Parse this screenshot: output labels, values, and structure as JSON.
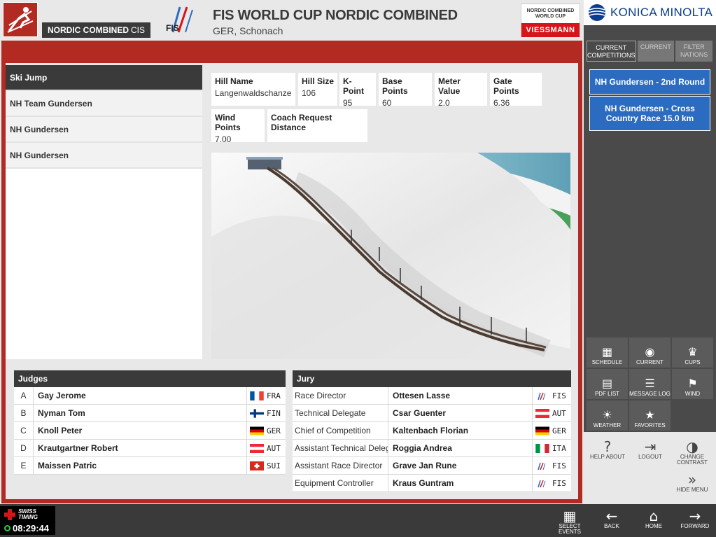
{
  "header": {
    "badge_main": "NORDIC COMBINED",
    "badge_suffix": "CIS",
    "fis_text": "FIS",
    "title": "FIS WORLD CUP NORDIC COMBINED",
    "subtitle": "GER, Schonach",
    "sponsor_top": "NORDIC COMBINED WORLD CUP",
    "sponsor_bottom": "VIESSMANN",
    "km_logo": "KONICA MINOLTA"
  },
  "competitions": [
    {
      "label": "Ski Jump",
      "active": true
    },
    {
      "label": "NH Team Gundersen",
      "active": false
    },
    {
      "label": "NH Gundersen",
      "active": false
    },
    {
      "label": "NH Gundersen",
      "active": false
    }
  ],
  "hill": {
    "name_label": "Hill Name",
    "name_value": "Langenwaldschanze",
    "size_label": "Hill Size",
    "size_value": "106",
    "kpoint_label": "K-Point",
    "kpoint_value": "95",
    "base_label": "Base Points",
    "base_value": "60",
    "meter_label": "Meter Value",
    "meter_value": "2.0",
    "gate_label": "Gate Points",
    "gate_value": "6.36",
    "wind_label": "Wind Points",
    "wind_value": "7.00",
    "coach_label": "Coach Request Distance",
    "coach_value": ""
  },
  "judges": {
    "title": "Judges",
    "rows": [
      {
        "letter": "A",
        "name": "Gay Jerome",
        "nation": "FRA"
      },
      {
        "letter": "B",
        "name": "Nyman Tom",
        "nation": "FIN"
      },
      {
        "letter": "C",
        "name": "Knoll Peter",
        "nation": "GER"
      },
      {
        "letter": "D",
        "name": "Krautgartner Robert",
        "nation": "AUT"
      },
      {
        "letter": "E",
        "name": "Maissen Patric",
        "nation": "SUI"
      }
    ]
  },
  "jury": {
    "title": "Jury",
    "rows": [
      {
        "role": "Race Director",
        "name": "Ottesen Lasse",
        "nation": "FIS"
      },
      {
        "role": "Technical Delegate",
        "name": "Csar Guenter",
        "nation": "AUT"
      },
      {
        "role": "Chief of Competition",
        "name": "Kaltenbach Florian",
        "nation": "GER"
      },
      {
        "role": "Assistant Technical Delegate",
        "name": "Roggia Andrea",
        "nation": "ITA"
      },
      {
        "role": "Assistant Race Director",
        "name": "Grave Jan Rune",
        "nation": "FIS"
      },
      {
        "role": "Equipment Controller",
        "name": "Kraus Guntram",
        "nation": "FIS"
      }
    ]
  },
  "sidebar": {
    "tabs": [
      {
        "label": "CURRENT COMPETITIONS",
        "active": true
      },
      {
        "label": "CURRENT",
        "active": false
      },
      {
        "label": "FILTER NATIONS",
        "active": false
      }
    ],
    "items": [
      {
        "label": "NH Gundersen - 2nd Round"
      },
      {
        "label": "NH Gundersen - Cross Country Race 15.0 km"
      }
    ],
    "menu": [
      {
        "label": "SCHEDULE",
        "icon": "calendar-icon",
        "glyph": "▦"
      },
      {
        "label": "CURRENT",
        "icon": "eye-icon",
        "glyph": "◉"
      },
      {
        "label": "CUPS",
        "icon": "trophy-icon",
        "glyph": "♛"
      },
      {
        "label": "PDF LIST",
        "icon": "pdf-icon",
        "glyph": "▤"
      },
      {
        "label": "MESSAGE LOG",
        "icon": "list-icon",
        "glyph": "☰"
      },
      {
        "label": "WIND",
        "icon": "windsock-icon",
        "glyph": "⚑"
      },
      {
        "label": "WEATHER",
        "icon": "sun-icon",
        "glyph": "☀"
      },
      {
        "label": "FAVORITES",
        "icon": "star-icon",
        "glyph": "★"
      }
    ],
    "utils": [
      {
        "label": "HELP ABOUT",
        "icon": "help-icon",
        "glyph": "?"
      },
      {
        "label": "LOGOUT",
        "icon": "logout-icon",
        "glyph": "⇥"
      },
      {
        "label": "CHANGE CONTRAST",
        "icon": "contrast-icon",
        "glyph": "◑"
      },
      {
        "label": "HIDE MENU",
        "icon": "hide-menu-icon",
        "glyph": "»"
      }
    ]
  },
  "footer": {
    "brand": "SWISS TIMING",
    "clock": "08:29:44",
    "buttons": [
      {
        "label": "SELECT EVENTS",
        "icon": "grid-icon",
        "glyph": "▦"
      },
      {
        "label": "BACK",
        "icon": "arrow-left-icon",
        "glyph": "←"
      },
      {
        "label": "HOME",
        "icon": "home-icon",
        "glyph": "⌂"
      },
      {
        "label": "FORWARD",
        "icon": "arrow-right-icon",
        "glyph": "→"
      }
    ]
  },
  "colors": {
    "brand_red": "#b32a23",
    "dark": "#3a3a3a",
    "active_blue": "#2b6cc0"
  }
}
